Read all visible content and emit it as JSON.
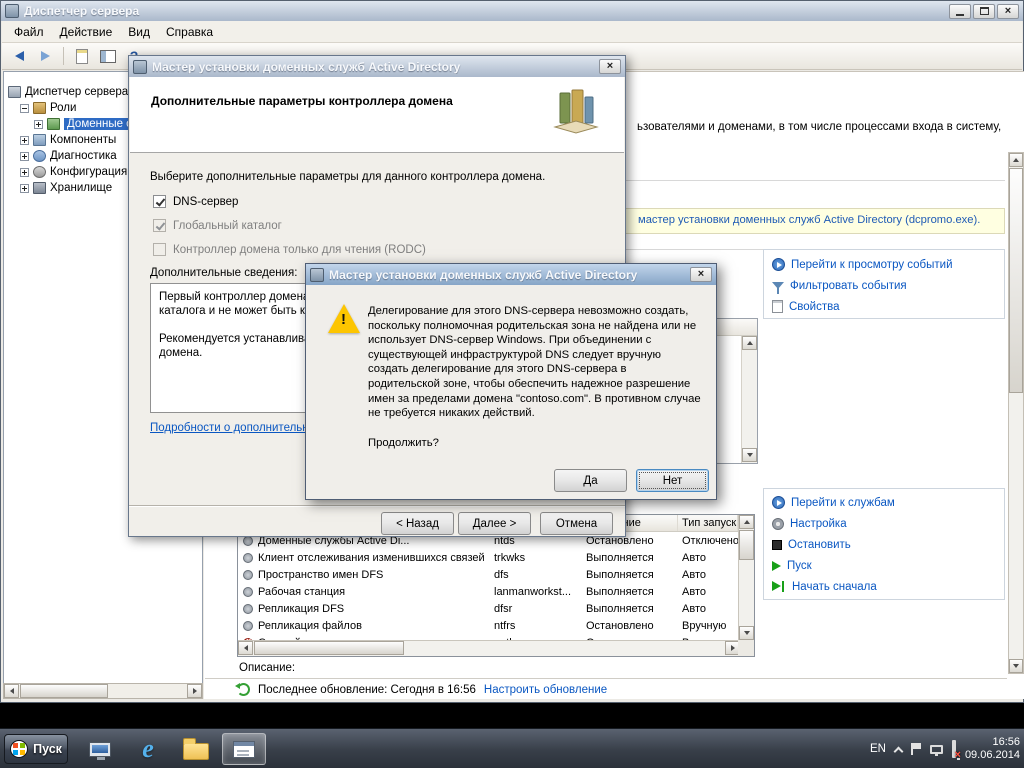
{
  "main_window": {
    "title": "Диспетчер сервера",
    "menu": [
      "Файл",
      "Действие",
      "Вид",
      "Справка"
    ],
    "tree": {
      "root": "Диспетчер сервера",
      "items": [
        "Роли",
        "Доменные с...",
        "Компоненты",
        "Диагностика",
        "Конфигурация",
        "Хранилище"
      ]
    },
    "content": {
      "intro_fragment": "ьзователями и доменами, в том числе процессами входа в систему,",
      "notice_fragment": "мастер установки доменных служб Active Directory (dcpromo.exe).",
      "events_links": [
        "Перейти к просмотру событий",
        "Фильтровать события",
        "Свойства"
      ],
      "services_links": [
        "Перейти к службам",
        "Настройка",
        "Остановить",
        "Пуск",
        "Начать сначала"
      ],
      "services_table": {
        "col_status": "Состояние",
        "col_startup": "Тип запуска",
        "rows": [
          {
            "name": "Доменные службы Active Di...",
            "service": "ntds",
            "status": "Остановлено",
            "startup": "Отключено"
          },
          {
            "name": "Клиент отслеживания изменившихся связей",
            "service": "trkwks",
            "status": "Выполняется",
            "startup": "Авто"
          },
          {
            "name": "Пространство имен DFS",
            "service": "dfs",
            "status": "Выполняется",
            "startup": "Авто"
          },
          {
            "name": "Рабочая станция",
            "service": "lanmanworkst...",
            "status": "Выполняется",
            "startup": "Авто"
          },
          {
            "name": "Репликация DFS",
            "service": "dfsr",
            "status": "Выполняется",
            "startup": "Авто"
          },
          {
            "name": "Репликация файлов",
            "service": "ntfrs",
            "status": "Остановлено",
            "startup": "Вручную"
          },
          {
            "name": "Сетевой вход в систему",
            "service": "netlogon",
            "status": "Остановлено",
            "startup": "Вручную"
          }
        ]
      },
      "description_label": "Описание:",
      "refresh_status": "Последнее обновление: Сегодня в 16:56",
      "refresh_link": "Настроить обновление"
    }
  },
  "wizard": {
    "title": "Мастер установки доменных служб Active Directory",
    "page_title": "Дополнительные параметры контроллера домена",
    "instruction": "Выберите дополнительные параметры для данного контроллера домена.",
    "checkboxes": [
      {
        "label": "DNS-сервер",
        "checked": true,
        "enabled": true
      },
      {
        "label": "Глобальный каталог",
        "checked": true,
        "enabled": false
      },
      {
        "label": "Контроллер домена только для чтения (RODC)",
        "checked": false,
        "enabled": false
      }
    ],
    "details_label": "Дополнительные сведения:",
    "details_lines": [
      "Первый контроллер домена в лесу должен быть сервером глобального",
      "каталога и не может быть контроллером домена только для чтения.",
      "",
      "Рекомендуется устанавливать DNS-сервер на первом контроллере",
      "домена."
    ],
    "details_link": "Подробности о дополнительных параметрах контроллера домена",
    "buttons": {
      "back": "< Назад",
      "next": "Далее >",
      "cancel": "Отмена"
    }
  },
  "warning_dialog": {
    "title": "Мастер установки доменных служб Active Directory",
    "message_lines": [
      "Делегирование для этого DNS-сервера невозможно создать,",
      "поскольку полномочная родительская зона не найдена или не",
      "использует DNS-сервер Windows. При объединении с",
      "существующей инфраструктурой DNS следует вручную",
      "создать делегирование для этого DNS-сервера в",
      "родительской зоне, чтобы обеспечить надежное разрешение",
      "имен за пределами домена \"contoso.com\". В противном случае",
      "не требуется никаких действий."
    ],
    "question": "Продолжить?",
    "buttons": {
      "yes": "Да",
      "no": "Нет"
    }
  },
  "taskbar": {
    "start_label": "Пуск",
    "tray": {
      "lang": "EN",
      "time": "16:56",
      "date": "09.06.2014"
    }
  }
}
